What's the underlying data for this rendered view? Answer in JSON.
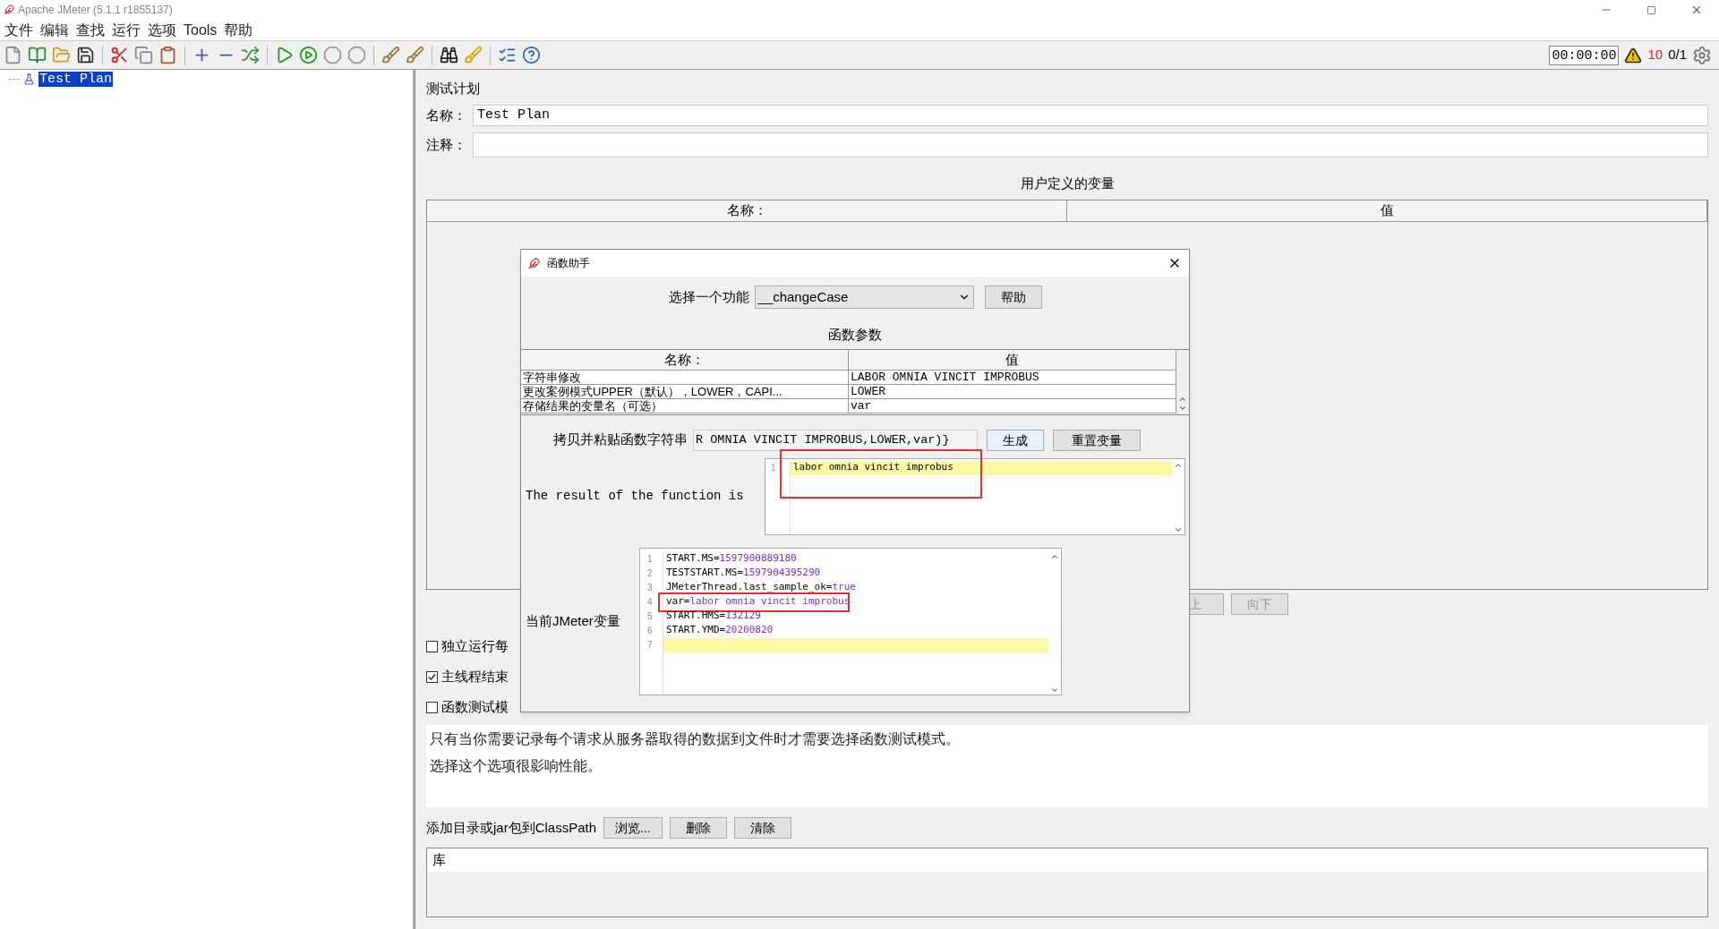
{
  "window": {
    "title": "Apache JMeter (5.1.1 r1855137)"
  },
  "menu": [
    {
      "label": "文件"
    },
    {
      "label": "编辑"
    },
    {
      "label": "查找"
    },
    {
      "label": "运行"
    },
    {
      "label": "选项"
    },
    {
      "label": "Tools"
    },
    {
      "label": "帮助"
    }
  ],
  "status": {
    "timer": "00:00:00",
    "warnings": "10",
    "threads": "0/1"
  },
  "tree": [
    {
      "label": "Test Plan",
      "selected": true
    }
  ],
  "panel": {
    "title": "测试计划",
    "name_label": "名称：",
    "name_value": "Test Plan",
    "comment_label": "注释：",
    "variables_title": "用户定义的变量",
    "columns": [
      "名称：",
      "值"
    ],
    "buttons": [
      {
        "label": "上"
      },
      {
        "label": "向下"
      }
    ],
    "checkboxes": [
      {
        "label": "独立运行每",
        "checked": false
      },
      {
        "label": "主线程结束",
        "checked": true
      },
      {
        "label": "函数测试模",
        "checked": false
      }
    ],
    "description": [
      "只有当你需要记录每个请求从服务器取得的数据到文件时才需要选择函数测试模式。",
      "选择这个选项很影响性能。"
    ],
    "classpath_label": "添加目录或jar包到ClassPath",
    "classpath_buttons": [
      "浏览...",
      "删除",
      "清除"
    ],
    "library_column": "库"
  },
  "dialog": {
    "title": "函数助手",
    "select_label": "选择一个功能",
    "function": "__changeCase",
    "help_button": "帮助",
    "params_title": "函数参数",
    "columns": [
      "名称：",
      "值"
    ],
    "rows": [
      {
        "name": "字符串修改",
        "value": "LABOR OMNIA VINCIT IMPROBUS"
      },
      {
        "name": "更改案例模式UPPER（默认），LOWER，CAPI...",
        "value": "LOWER"
      },
      {
        "name": "存储结果的变量名（可选）",
        "value": "var"
      }
    ],
    "copy_label": "拷贝并粘贴函数字符串",
    "function_string": "R OMNIA VINCIT IMPROBUS,LOWER,var)}",
    "generate_button": "生成",
    "reset_button": "重置变量",
    "result_label": "The result of the function is",
    "result_lines": [
      {
        "number": "1",
        "text": "labor omnia vincit improbus",
        "current": true,
        "annotated": true
      }
    ],
    "variables_label": "当前JMeter变量",
    "variables": [
      {
        "number": "1",
        "key": "START.MS=",
        "value": "1597900889180",
        "current": false,
        "annotated": false
      },
      {
        "number": "2",
        "key": "TESTSTART.MS=",
        "value": "1597904395290",
        "current": false,
        "annotated": false
      },
      {
        "number": "3",
        "key": "JMeterThread.last_sample_ok=",
        "value": "true",
        "current": false,
        "annotated": false
      },
      {
        "number": "4",
        "key": "var=",
        "value": "labor omnia vincit improbus",
        "current": false,
        "annotated": true
      },
      {
        "number": "5",
        "key": "START.HMS=",
        "value": "132129",
        "current": false,
        "annotated": false
      },
      {
        "number": "6",
        "key": "START.YMD=",
        "value": "20200820",
        "current": false,
        "annotated": false
      },
      {
        "number": "7",
        "current": true,
        "annotated": false
      }
    ]
  }
}
